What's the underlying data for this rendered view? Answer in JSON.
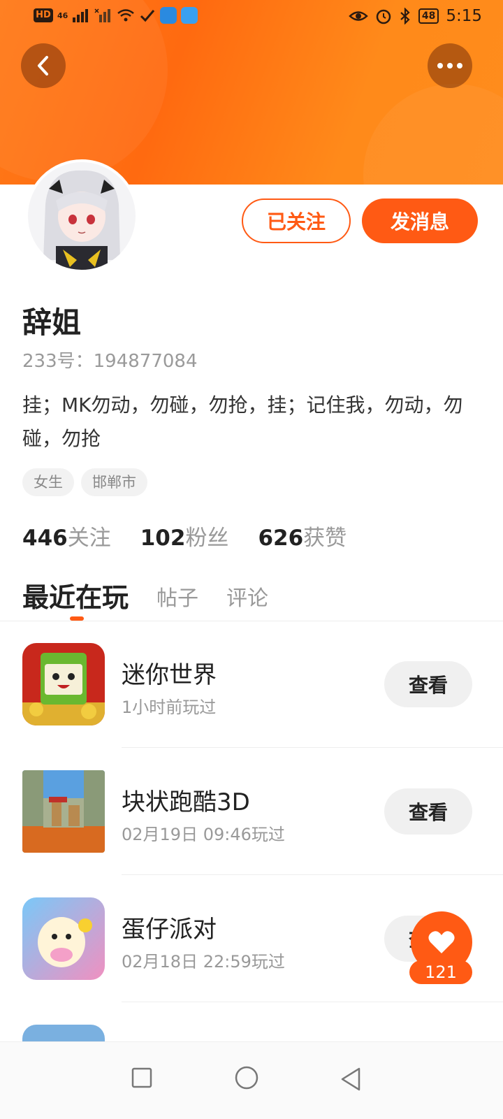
{
  "status_bar": {
    "left_badges": [
      "HD",
      "46"
    ],
    "battery": "48",
    "time": "5:15"
  },
  "header": {
    "back_icon": "chevron-left-icon",
    "more_icon": "more-dots-icon"
  },
  "profile": {
    "name": "辞姐",
    "uid": "233号：194877084",
    "bio": "挂；MK勿动，勿碰，勿抢，挂；记住我，勿动，勿碰，勿抢",
    "tags": [
      "女生",
      "邯郸市"
    ],
    "follow_button": "已关注",
    "message_button": "发消息"
  },
  "stats": [
    {
      "num": "446",
      "label": "关注"
    },
    {
      "num": "102",
      "label": "粉丝"
    },
    {
      "num": "626",
      "label": "获赞"
    }
  ],
  "tabs": [
    {
      "label": "最近在玩",
      "active": true
    },
    {
      "label": "帖子",
      "active": false
    },
    {
      "label": "评论",
      "active": false
    }
  ],
  "games": [
    {
      "name": "迷你世界",
      "time": "1小时前玩过",
      "button": "查看"
    },
    {
      "name": "块状跑酷3D",
      "time": "02月19日 09:46玩过",
      "button": "查看"
    },
    {
      "name": "蛋仔派对",
      "time": "02月18日 22:59玩过",
      "button": "查看"
    }
  ],
  "like": {
    "count": "121",
    "icon": "heart-icon"
  },
  "colors": {
    "accent": "#ff5a14",
    "header": "#ff7a18"
  }
}
